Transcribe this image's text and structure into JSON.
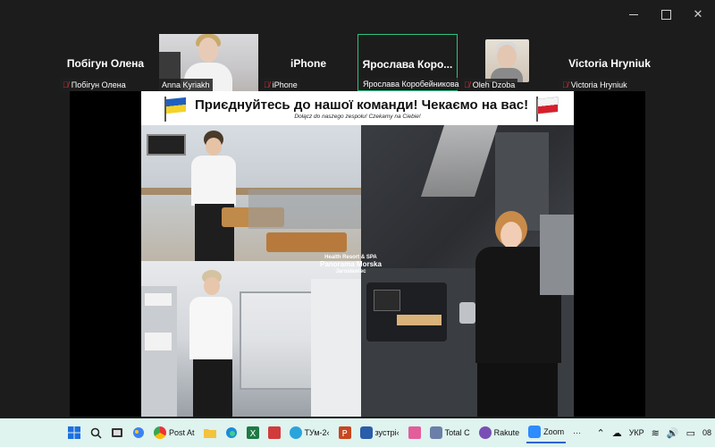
{
  "window": {
    "controls": [
      "minimize",
      "maximize",
      "close"
    ],
    "close_glyph": "✕"
  },
  "participants": [
    {
      "big_name": "Побігун Олена",
      "tag": "Побігун Олена",
      "muted": true
    },
    {
      "big_name": "",
      "tag": "Anna Kyriakh",
      "muted": false,
      "video": true
    },
    {
      "big_name": "iPhone",
      "tag": "iPhone",
      "muted": true
    },
    {
      "big_name": "Ярослава  Коро...",
      "tag": "Ярослава Коробейникова",
      "muted": false,
      "active": true
    },
    {
      "big_name": "",
      "tag": "Oleh Dzoba",
      "muted": true,
      "video": true
    },
    {
      "big_name": "Victoria Hryniuk",
      "tag": "Victoria Hryniuk",
      "muted": true
    }
  ],
  "poster": {
    "headline": "Приєднуйтесь до нашої команди! Чекаємо на вас!",
    "subline": "Dołącz do naszego zespołu! Czekamy na Ciebie!",
    "logo_line1": "Health Resort & SPA",
    "logo_line2": "Panorama Morska",
    "logo_line3": "Jarosławiec"
  },
  "taskbar": {
    "apps": [
      {
        "label": "Post At",
        "color": "#1d8f6e"
      },
      {
        "label": "ТУм-2‹",
        "color": "#2aa4dc"
      },
      {
        "label": "зустрі‹",
        "color": "#2b5ea9"
      },
      {
        "label": "Total C",
        "color": "#6b7fa8"
      },
      {
        "label": "Rakute",
        "color": "#7a4fb5"
      },
      {
        "label": "Zoom",
        "color": "#2d8cff",
        "active": true
      }
    ],
    "more": "···",
    "language": "УКР",
    "time_partial": "08"
  },
  "colors": {
    "mute": "#e0363a",
    "active_border": "#2ec27e",
    "taskbar_bg": "#dff3ef"
  }
}
